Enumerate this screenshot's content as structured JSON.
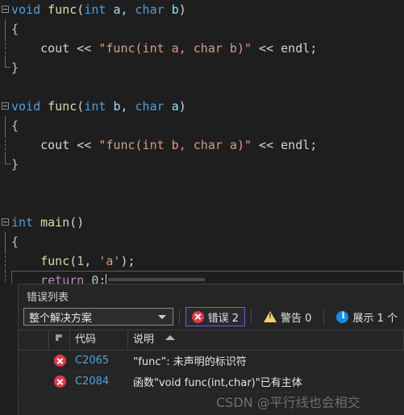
{
  "editor": {
    "background": "#1e1e1e",
    "lines": [
      {
        "fold": "start",
        "indent": 0,
        "tokens": [
          {
            "t": "void",
            "c": "kw"
          },
          {
            "t": " ",
            "c": "plain"
          },
          {
            "t": "func",
            "c": "fn"
          },
          {
            "t": "(",
            "c": "punc"
          },
          {
            "t": "int",
            "c": "kw"
          },
          {
            "t": " ",
            "c": "plain"
          },
          {
            "t": "a",
            "c": "var"
          },
          {
            "t": ", ",
            "c": "punc"
          },
          {
            "t": "char",
            "c": "kw"
          },
          {
            "t": " ",
            "c": "plain"
          },
          {
            "t": "b",
            "c": "var"
          },
          {
            "t": ")",
            "c": "punc"
          }
        ]
      },
      {
        "fold": "bar",
        "indent": 1,
        "tokens": [
          {
            "t": "{",
            "c": "brace"
          }
        ]
      },
      {
        "fold": "dashed",
        "indent": 1,
        "tokens": [
          {
            "t": "    ",
            "c": "plain"
          },
          {
            "t": "cout",
            "c": "obj"
          },
          {
            "t": " << ",
            "c": "punc"
          },
          {
            "t": "\"func(int a, char b)\"",
            "c": "str"
          },
          {
            "t": " << ",
            "c": "punc"
          },
          {
            "t": "endl",
            "c": "obj"
          },
          {
            "t": ";",
            "c": "punc"
          }
        ]
      },
      {
        "fold": "end",
        "indent": 1,
        "tokens": [
          {
            "t": "}",
            "c": "brace"
          }
        ]
      },
      {
        "fold": "none",
        "indent": 0,
        "tokens": []
      },
      {
        "fold": "start",
        "indent": 0,
        "tokens": [
          {
            "t": "void",
            "c": "kw"
          },
          {
            "t": " ",
            "c": "plain"
          },
          {
            "t": "func",
            "c": "fn"
          },
          {
            "t": "(",
            "c": "punc"
          },
          {
            "t": "int",
            "c": "kw"
          },
          {
            "t": " ",
            "c": "plain"
          },
          {
            "t": "b",
            "c": "var"
          },
          {
            "t": ", ",
            "c": "punc"
          },
          {
            "t": "char",
            "c": "kw"
          },
          {
            "t": " ",
            "c": "plain"
          },
          {
            "t": "a",
            "c": "var"
          },
          {
            "t": ")",
            "c": "punc"
          }
        ]
      },
      {
        "fold": "bar",
        "indent": 1,
        "tokens": [
          {
            "t": "{",
            "c": "brace"
          }
        ]
      },
      {
        "fold": "dashed",
        "indent": 1,
        "tokens": [
          {
            "t": "    ",
            "c": "plain"
          },
          {
            "t": "cout",
            "c": "obj"
          },
          {
            "t": " << ",
            "c": "punc"
          },
          {
            "t": "\"func(int b, char a)\"",
            "c": "str"
          },
          {
            "t": " << ",
            "c": "punc"
          },
          {
            "t": "endl",
            "c": "obj"
          },
          {
            "t": ";",
            "c": "punc"
          }
        ]
      },
      {
        "fold": "end",
        "indent": 1,
        "tokens": [
          {
            "t": "}",
            "c": "brace"
          }
        ]
      },
      {
        "fold": "none",
        "indent": 0,
        "tokens": []
      },
      {
        "fold": "none",
        "indent": 0,
        "tokens": []
      },
      {
        "fold": "start",
        "indent": 0,
        "tokens": [
          {
            "t": "int",
            "c": "kw"
          },
          {
            "t": " ",
            "c": "plain"
          },
          {
            "t": "main",
            "c": "fn"
          },
          {
            "t": "()",
            "c": "punc"
          }
        ]
      },
      {
        "fold": "bar",
        "indent": 1,
        "tokens": [
          {
            "t": "{",
            "c": "brace"
          }
        ]
      },
      {
        "fold": "dashed",
        "indent": 1,
        "tokens": [
          {
            "t": "    ",
            "c": "plain"
          },
          {
            "t": "func",
            "c": "fn"
          },
          {
            "t": "(",
            "c": "punc"
          },
          {
            "t": "1",
            "c": "num"
          },
          {
            "t": ", ",
            "c": "punc"
          },
          {
            "t": "'a'",
            "c": "str"
          },
          {
            "t": ");",
            "c": "punc"
          }
        ]
      },
      {
        "fold": "dashed",
        "indent": 1,
        "current": true,
        "tokens": [
          {
            "t": "    ",
            "c": "plain"
          },
          {
            "t": "return",
            "c": "ctrl"
          },
          {
            "t": " ",
            "c": "plain"
          },
          {
            "t": "0",
            "c": "num"
          },
          {
            "t": ";",
            "c": "punc"
          }
        ]
      },
      {
        "fold": "end",
        "indent": 1,
        "tokens": [
          {
            "t": "}",
            "c": "brace"
          }
        ]
      }
    ]
  },
  "error_panel": {
    "title": "错误列表",
    "filter": {
      "value": "整个解决方案",
      "chevron_icon": "chevron-down-icon"
    },
    "toolbar_buttons": [
      {
        "icon": "error-icon",
        "label": "错误 2",
        "active": true
      },
      {
        "icon": "warning-icon",
        "label": "警告 0",
        "active": false
      },
      {
        "icon": "info-icon",
        "label": "展示 1 个",
        "active": false
      }
    ],
    "columns": [
      {
        "key": "blank",
        "label": ""
      },
      {
        "key": "icon",
        "label": ""
      },
      {
        "key": "code",
        "label": "代码"
      },
      {
        "key": "desc",
        "label": "说明",
        "sort": "asc",
        "sort_icon": "sort-asc-icon"
      }
    ],
    "rows": [
      {
        "severity_icon": "error-icon",
        "code": "C2065",
        "description": "“func”: 未声明的标识符"
      },
      {
        "severity_icon": "error-icon",
        "code": "C2084",
        "description": "函数\"void func(int,char)\"已有主体"
      }
    ]
  },
  "watermark": {
    "text": "CSDN @平行线也会相交"
  },
  "colors": {
    "editor_bg": "#1e1e1e",
    "panel_bg": "#252526",
    "keyword": "#569cd6",
    "function": "#dcdcaa",
    "string": "#d69d85",
    "number": "#b5cea8",
    "control": "#c586c0",
    "error_red": "#e03a4e",
    "warn_yellow": "#f2d06b",
    "info_blue": "#1a8ce0",
    "link_blue": "#4ea3e0",
    "focus_purple": "#6c5ce7"
  }
}
